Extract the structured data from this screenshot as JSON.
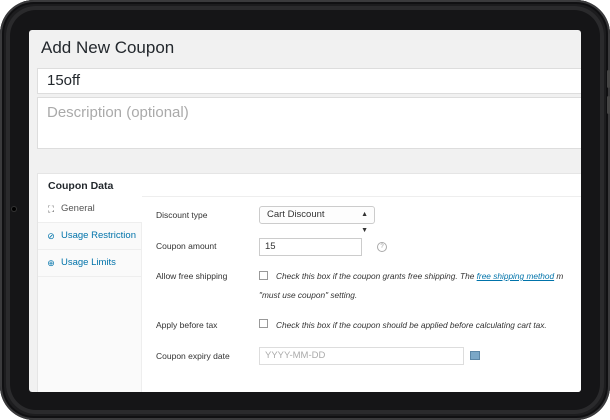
{
  "page_title": "Add New Coupon",
  "coupon_code": "15off",
  "description_placeholder": "Description (optional)",
  "panel_title": "Coupon Data",
  "tabs": [
    {
      "label": "General",
      "icon": "general-icon"
    },
    {
      "label": "Usage Restriction",
      "icon": "restriction-icon"
    },
    {
      "label": "Usage Limits",
      "icon": "limits-icon"
    }
  ],
  "fields": {
    "discount_type": {
      "label": "Discount type",
      "value": "Cart Discount"
    },
    "coupon_amount": {
      "label": "Coupon amount",
      "value": "15"
    },
    "free_shipping": {
      "label": "Allow free shipping",
      "desc_before": "Check this box if the coupon grants free shipping. The ",
      "desc_link": "free shipping method",
      "desc_after": " m",
      "desc_line2": "\"must use coupon\" setting."
    },
    "apply_before_tax": {
      "label": "Apply before tax",
      "desc": "Check this box if the coupon should be applied before calculating cart tax."
    },
    "expiry_date": {
      "label": "Coupon expiry date",
      "placeholder": "YYYY-MM-DD"
    }
  }
}
